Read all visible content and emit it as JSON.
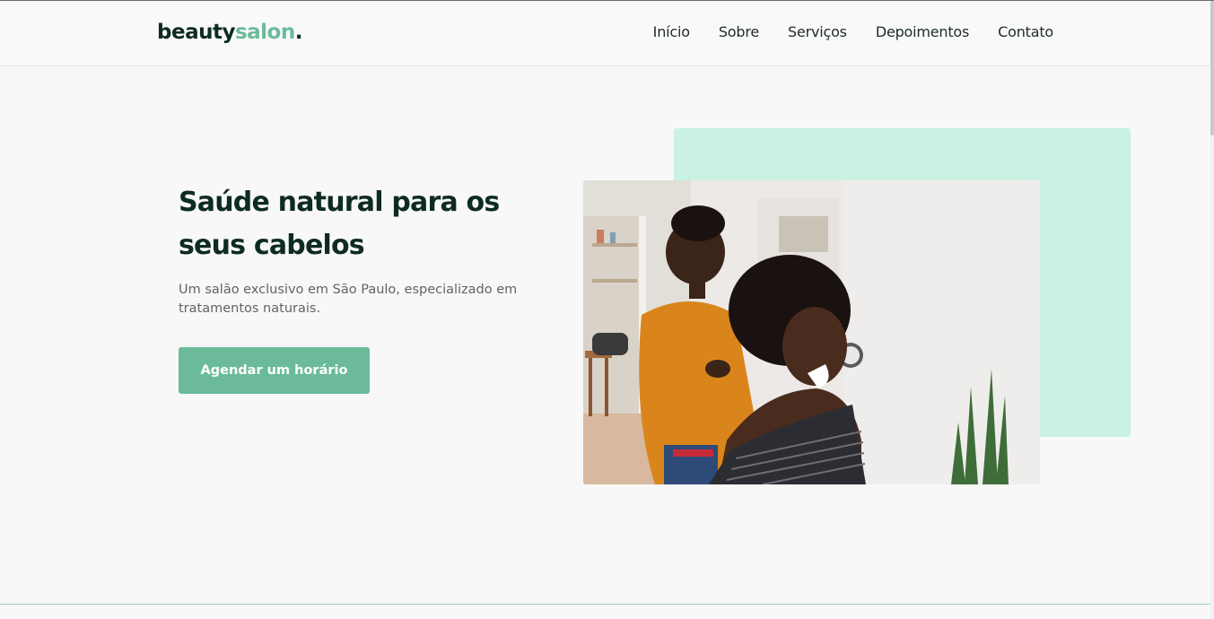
{
  "brand": {
    "name_dark": "beauty",
    "name_accent": "salon",
    "dot": "."
  },
  "nav": {
    "items": [
      {
        "label": "Início"
      },
      {
        "label": "Sobre"
      },
      {
        "label": "Serviços"
      },
      {
        "label": "Depoimentos"
      },
      {
        "label": "Contato"
      }
    ]
  },
  "hero": {
    "title": "Saúde natural para os seus cabelos",
    "subtitle": "Um salão exclusivo em São Paulo, especializado em tratamentos naturais.",
    "cta_label": "Agendar um horário"
  },
  "colors": {
    "accent": "#6bbb9b",
    "mint": "#c9f2e3",
    "dark": "#0e2b22"
  }
}
